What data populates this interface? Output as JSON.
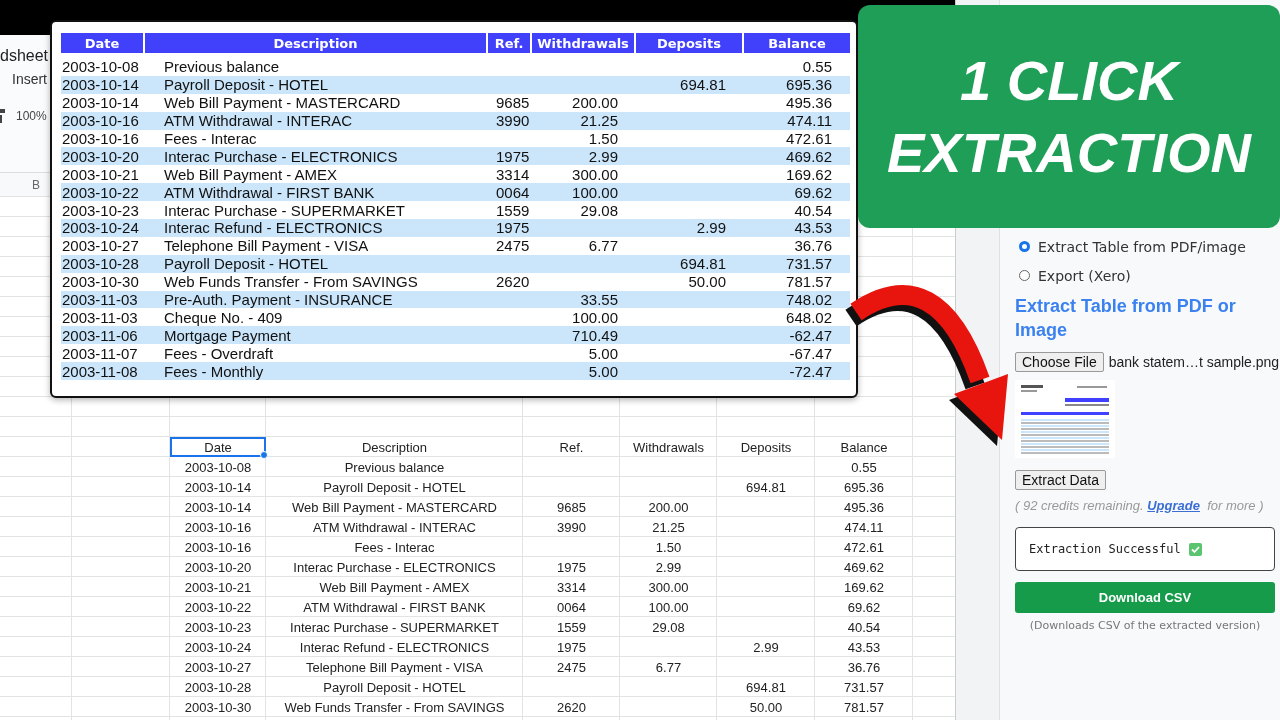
{
  "sheet": {
    "title_fragment": "dsheet",
    "menu_fragment": "Insert",
    "zoom": "100%",
    "column_header": "B",
    "columns": [
      {
        "label": "Date",
        "selected": true
      },
      {
        "label": "Description",
        "selected": false
      },
      {
        "label": "Ref.",
        "selected": false
      },
      {
        "label": "Withdrawals",
        "selected": false
      },
      {
        "label": "Deposits",
        "selected": false
      },
      {
        "label": "Balance",
        "selected": false
      }
    ],
    "rows": [
      {
        "date": "2003-10-08",
        "description": "Previous balance",
        "balance": "0.55"
      },
      {
        "date": "2003-10-14",
        "description": "Payroll Deposit - HOTEL",
        "deposits": "694.81",
        "balance": "695.36"
      },
      {
        "date": "2003-10-14",
        "description": "Web Bill Payment - MASTERCARD",
        "ref": "9685",
        "withdrawals": "200.00",
        "balance": "495.36"
      },
      {
        "date": "2003-10-16",
        "description": "ATM Withdrawal - INTERAC",
        "ref": "3990",
        "withdrawals": "21.25",
        "balance": "474.11"
      },
      {
        "date": "2003-10-16",
        "description": "Fees - Interac",
        "withdrawals": "1.50",
        "balance": "472.61"
      },
      {
        "date": "2003-10-20",
        "description": "Interac Purchase - ELECTRONICS",
        "ref": "1975",
        "withdrawals": "2.99",
        "balance": "469.62"
      },
      {
        "date": "2003-10-21",
        "description": "Web Bill Payment - AMEX",
        "ref": "3314",
        "withdrawals": "300.00",
        "balance": "169.62"
      },
      {
        "date": "2003-10-22",
        "description": "ATM Withdrawal - FIRST BANK",
        "ref": "0064",
        "withdrawals": "100.00",
        "balance": "69.62"
      },
      {
        "date": "2003-10-23",
        "description": "Interac Purchase - SUPERMARKET",
        "ref": "1559",
        "withdrawals": "29.08",
        "balance": "40.54"
      },
      {
        "date": "2003-10-24",
        "description": "Interac Refund - ELECTRONICS",
        "ref": "1975",
        "deposits": "2.99",
        "balance": "43.53"
      },
      {
        "date": "2003-10-27",
        "description": "Telephone Bill Payment - VISA",
        "ref": "2475",
        "withdrawals": "6.77",
        "balance": "36.76"
      },
      {
        "date": "2003-10-28",
        "description": "Payroll Deposit - HOTEL",
        "deposits": "694.81",
        "balance": "731.57"
      },
      {
        "date": "2003-10-30",
        "description": "Web Funds Transfer - From SAVINGS",
        "ref": "2620",
        "deposits": "50.00",
        "balance": "781.57"
      }
    ]
  },
  "statement": {
    "columns": [
      "Date",
      "Description",
      "Ref.",
      "Withdrawals",
      "Deposits",
      "Balance"
    ],
    "rows": [
      {
        "date": "2003-10-08",
        "description": "Previous balance",
        "balance": "0.55"
      },
      {
        "date": "2003-10-14",
        "description": "Payroll Deposit - HOTEL",
        "deposits": "694.81",
        "balance": "695.36"
      },
      {
        "date": "2003-10-14",
        "description": "Web Bill Payment - MASTERCARD",
        "ref": "9685",
        "withdrawals": "200.00",
        "balance": "495.36"
      },
      {
        "date": "2003-10-16",
        "description": "ATM Withdrawal - INTERAC",
        "ref": "3990",
        "withdrawals": "21.25",
        "balance": "474.11"
      },
      {
        "date": "2003-10-16",
        "description": "Fees - Interac",
        "withdrawals": "1.50",
        "balance": "472.61"
      },
      {
        "date": "2003-10-20",
        "description": "Interac Purchase - ELECTRONICS",
        "ref": "1975",
        "withdrawals": "2.99",
        "balance": "469.62"
      },
      {
        "date": "2003-10-21",
        "description": "Web Bill Payment - AMEX",
        "ref": "3314",
        "withdrawals": "300.00",
        "balance": "169.62"
      },
      {
        "date": "2003-10-22",
        "description": "ATM Withdrawal - FIRST BANK",
        "ref": "0064",
        "withdrawals": "100.00",
        "balance": "69.62"
      },
      {
        "date": "2003-10-23",
        "description": "Interac Purchase - SUPERMARKET",
        "ref": "1559",
        "withdrawals": "29.08",
        "balance": "40.54"
      },
      {
        "date": "2003-10-24",
        "description": "Interac Refund - ELECTRONICS",
        "ref": "1975",
        "deposits": "2.99",
        "balance": "43.53"
      },
      {
        "date": "2003-10-27",
        "description": "Telephone Bill Payment - VISA",
        "ref": "2475",
        "withdrawals": "6.77",
        "balance": "36.76"
      },
      {
        "date": "2003-10-28",
        "description": "Payroll Deposit - HOTEL",
        "deposits": "694.81",
        "balance": "731.57"
      },
      {
        "date": "2003-10-30",
        "description": "Web Funds Transfer - From  SAVINGS",
        "ref": "2620",
        "deposits": "50.00",
        "balance": "781.57"
      },
      {
        "date": "2003-11-03",
        "description": "Pre-Auth. Payment - INSURANCE",
        "withdrawals": "33.55",
        "balance": "748.02"
      },
      {
        "date": "2003-11-03",
        "description": "Cheque No. - 409",
        "withdrawals": "100.00",
        "balance": "648.02"
      },
      {
        "date": "2003-11-06",
        "description": "Mortgage Payment",
        "withdrawals": "710.49",
        "balance": "-62.47"
      },
      {
        "date": "2003-11-07",
        "description": "Fees - Overdraft",
        "withdrawals": "5.00",
        "balance": "-67.47"
      },
      {
        "date": "2003-11-08",
        "description": "Fees - Monthly",
        "withdrawals": "5.00",
        "balance": "-72.47"
      }
    ]
  },
  "banner": {
    "lines": [
      "1 CLICK",
      "EXTRACTION"
    ]
  },
  "panel": {
    "options": [
      {
        "label": "Extract Table from PDF/image",
        "selected": true
      },
      {
        "label": "Export (Xero)",
        "selected": false
      }
    ],
    "heading": "Extract Table from PDF or Image",
    "file_button": "Choose File",
    "file_name": "bank statem…t sample.png",
    "extract_button": "Extract Data",
    "credits": {
      "before": "( 92 credits remaining.",
      "link": "Upgrade",
      "after": "for more )"
    },
    "status": "Extraction Successful",
    "download_button": "Download CSV",
    "note": "(Downloads CSV of the extracted version)"
  }
}
